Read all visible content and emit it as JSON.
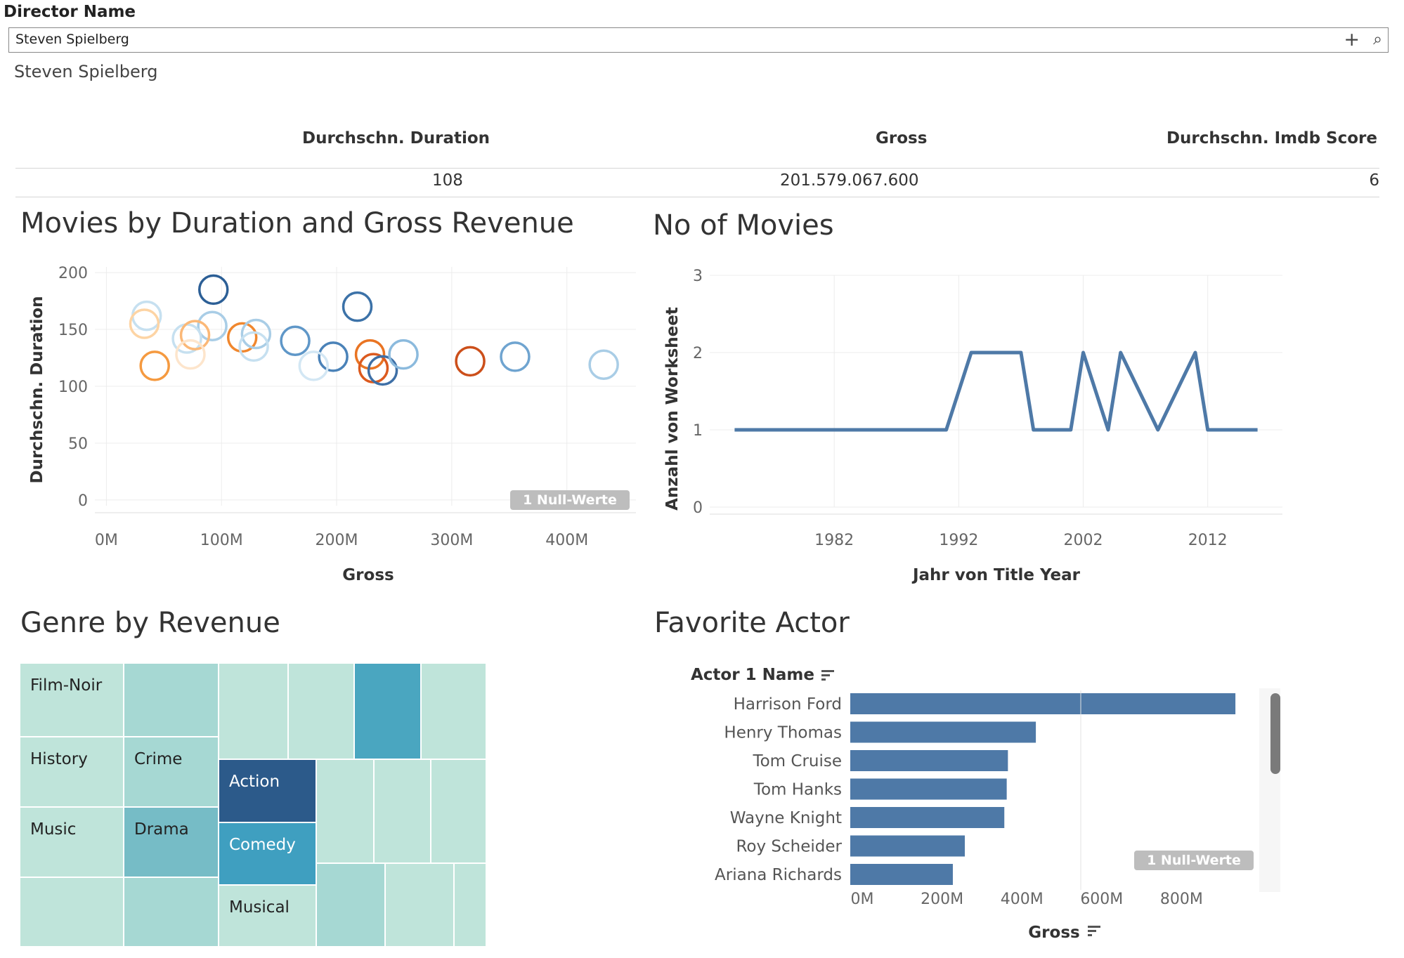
{
  "filter": {
    "label": "Director Name",
    "value": "Steven Spielberg",
    "selected_display": "Steven Spielberg",
    "icons": [
      "plus-icon",
      "search-icon"
    ]
  },
  "kpis": [
    {
      "label": "Durchschn. Duration",
      "value": "108"
    },
    {
      "label": "Gross",
      "value": "201.579.067.600"
    },
    {
      "label": "Durchschn. Imdb Score",
      "value": "6"
    }
  ],
  "scatter": {
    "title": "Movies by Duration and Gross Revenue",
    "null_badge": "1 Null-Werte"
  },
  "line": {
    "title": "No of Movies",
    "null_badge": ""
  },
  "treemap": {
    "title": "Genre by Revenue",
    "labels": {
      "film_noir": "Film-Noir",
      "history": "History",
      "crime": "Crime",
      "action": "Action",
      "music": "Music",
      "drama": "Drama",
      "comedy": "Comedy",
      "musical": "Musical"
    },
    "colors": {
      "light": "#bfe4da",
      "mid": "#a6d8d3",
      "teal": "#76bcc6",
      "blue": "#4aa6c0",
      "dark": "#2c5a8a",
      "comedy": "#3f9fc0"
    }
  },
  "bar": {
    "title": "Favorite Actor",
    "field_header": "Actor 1 Name",
    "null_badge": "1 Null-Werte"
  },
  "chart_data": [
    {
      "type": "scatter",
      "title": "Movies by Duration and Gross Revenue",
      "xlabel": "Gross",
      "ylabel": "Durchschn. Duration",
      "x_ticks": [
        "0M",
        "100M",
        "200M",
        "300M",
        "400M"
      ],
      "y_ticks": [
        "0",
        "50",
        "100",
        "150",
        "200"
      ],
      "xlim": [
        -10,
        460
      ],
      "ylim": [
        -5,
        205
      ],
      "points": [
        {
          "x": 93,
          "y": 185,
          "color": "#2c5f96"
        },
        {
          "x": 218,
          "y": 170,
          "color": "#3c72a8"
        },
        {
          "x": 35,
          "y": 162,
          "color": "#c6e0f0"
        },
        {
          "x": 33,
          "y": 155,
          "color": "#fdd4a4"
        },
        {
          "x": 92,
          "y": 153,
          "color": "#a9cde6"
        },
        {
          "x": 70,
          "y": 142,
          "color": "#c6e0f0"
        },
        {
          "x": 77,
          "y": 145,
          "color": "#fbb877"
        },
        {
          "x": 118,
          "y": 143,
          "color": "#f0872e"
        },
        {
          "x": 130,
          "y": 146,
          "color": "#a9cde6"
        },
        {
          "x": 128,
          "y": 135,
          "color": "#c6e0f0"
        },
        {
          "x": 164,
          "y": 140,
          "color": "#5f97c8"
        },
        {
          "x": 73,
          "y": 128,
          "color": "#fde5cc"
        },
        {
          "x": 42,
          "y": 118,
          "color": "#f59a40"
        },
        {
          "x": 197,
          "y": 126,
          "color": "#4a82b8"
        },
        {
          "x": 180,
          "y": 118,
          "color": "#d3e7f4"
        },
        {
          "x": 229,
          "y": 128,
          "color": "#e97423"
        },
        {
          "x": 232,
          "y": 116,
          "color": "#dc5a1e"
        },
        {
          "x": 240,
          "y": 114,
          "color": "#3e6fa6"
        },
        {
          "x": 258,
          "y": 128,
          "color": "#8bbadd"
        },
        {
          "x": 316,
          "y": 122,
          "color": "#cc4f1a"
        },
        {
          "x": 355,
          "y": 126,
          "color": "#6fa4d0"
        },
        {
          "x": 432,
          "y": 119,
          "color": "#a9cde6"
        }
      ]
    },
    {
      "type": "line",
      "title": "No of Movies",
      "xlabel": "Jahr von Title Year",
      "ylabel": "Anzahl von Worksheet",
      "x_ticks": [
        1982,
        1992,
        2002,
        2012
      ],
      "y_ticks": [
        0,
        1,
        2,
        3
      ],
      "xlim": [
        1972,
        2018
      ],
      "ylim": [
        0,
        3
      ],
      "series": [
        {
          "x": [
            1974,
            1991,
            1993,
            1997,
            1998,
            2001,
            2002,
            2004,
            2005,
            2008,
            2011,
            2012,
            2016
          ],
          "y": [
            1,
            1,
            2,
            2,
            1,
            1,
            2,
            1,
            2,
            1,
            2,
            1,
            1
          ],
          "color": "#4e79a7"
        }
      ]
    },
    {
      "type": "bar",
      "title": "Favorite Actor",
      "xlabel": "Gross",
      "x_ticks": [
        "0M",
        "200M",
        "400M",
        "600M",
        "800M"
      ],
      "xlim": [
        -30,
        1000
      ],
      "categories": [
        "Harrison Ford",
        "Henry Thomas",
        "Tom Cruise",
        "Tom Hanks",
        "Wayne Knight",
        "Roy Scheider",
        "Ariana Richards"
      ],
      "values": [
        935,
        435,
        365,
        362,
        356,
        257,
        227
      ],
      "color": "#4e79a7"
    }
  ]
}
